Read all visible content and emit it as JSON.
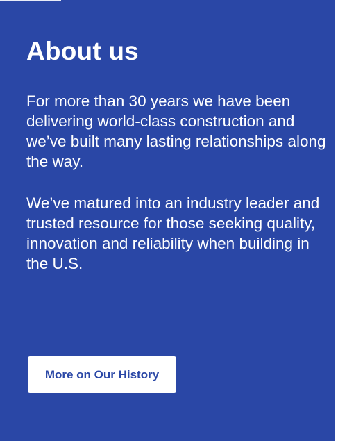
{
  "section": {
    "title": "About us",
    "paragraphs": [
      "For more than 30 years we have been delivering world-class construction and we’ve built many lasting relationships along the way.",
      "We’ve matured into an industry leader and trusted resource for those seeking quality, innovation and reliability when building in the U.S."
    ],
    "button_label": "More on Our History"
  },
  "colors": {
    "panel_background": "#2a47a6",
    "text": "#ffffff",
    "button_background": "#ffffff",
    "button_text": "#2a47a6"
  }
}
